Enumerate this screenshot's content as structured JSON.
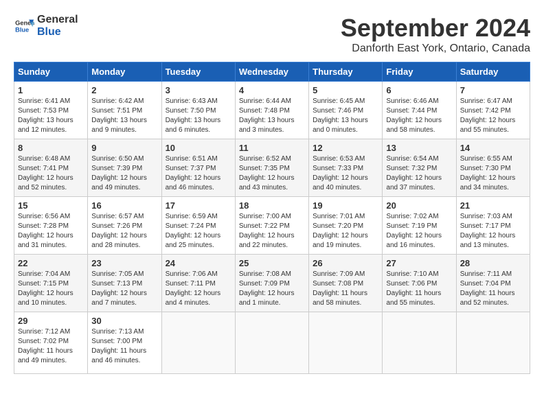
{
  "header": {
    "logo_general": "General",
    "logo_blue": "Blue",
    "month": "September 2024",
    "location": "Danforth East York, Ontario, Canada"
  },
  "days_of_week": [
    "Sunday",
    "Monday",
    "Tuesday",
    "Wednesday",
    "Thursday",
    "Friday",
    "Saturday"
  ],
  "weeks": [
    [
      {
        "day": "1",
        "sunrise": "6:41 AM",
        "sunset": "7:53 PM",
        "daylight": "13 hours and 12 minutes."
      },
      {
        "day": "2",
        "sunrise": "6:42 AM",
        "sunset": "7:51 PM",
        "daylight": "13 hours and 9 minutes."
      },
      {
        "day": "3",
        "sunrise": "6:43 AM",
        "sunset": "7:50 PM",
        "daylight": "13 hours and 6 minutes."
      },
      {
        "day": "4",
        "sunrise": "6:44 AM",
        "sunset": "7:48 PM",
        "daylight": "13 hours and 3 minutes."
      },
      {
        "day": "5",
        "sunrise": "6:45 AM",
        "sunset": "7:46 PM",
        "daylight": "13 hours and 0 minutes."
      },
      {
        "day": "6",
        "sunrise": "6:46 AM",
        "sunset": "7:44 PM",
        "daylight": "12 hours and 58 minutes."
      },
      {
        "day": "7",
        "sunrise": "6:47 AM",
        "sunset": "7:42 PM",
        "daylight": "12 hours and 55 minutes."
      }
    ],
    [
      {
        "day": "8",
        "sunrise": "6:48 AM",
        "sunset": "7:41 PM",
        "daylight": "12 hours and 52 minutes."
      },
      {
        "day": "9",
        "sunrise": "6:50 AM",
        "sunset": "7:39 PM",
        "daylight": "12 hours and 49 minutes."
      },
      {
        "day": "10",
        "sunrise": "6:51 AM",
        "sunset": "7:37 PM",
        "daylight": "12 hours and 46 minutes."
      },
      {
        "day": "11",
        "sunrise": "6:52 AM",
        "sunset": "7:35 PM",
        "daylight": "12 hours and 43 minutes."
      },
      {
        "day": "12",
        "sunrise": "6:53 AM",
        "sunset": "7:33 PM",
        "daylight": "12 hours and 40 minutes."
      },
      {
        "day": "13",
        "sunrise": "6:54 AM",
        "sunset": "7:32 PM",
        "daylight": "12 hours and 37 minutes."
      },
      {
        "day": "14",
        "sunrise": "6:55 AM",
        "sunset": "7:30 PM",
        "daylight": "12 hours and 34 minutes."
      }
    ],
    [
      {
        "day": "15",
        "sunrise": "6:56 AM",
        "sunset": "7:28 PM",
        "daylight": "12 hours and 31 minutes."
      },
      {
        "day": "16",
        "sunrise": "6:57 AM",
        "sunset": "7:26 PM",
        "daylight": "12 hours and 28 minutes."
      },
      {
        "day": "17",
        "sunrise": "6:59 AM",
        "sunset": "7:24 PM",
        "daylight": "12 hours and 25 minutes."
      },
      {
        "day": "18",
        "sunrise": "7:00 AM",
        "sunset": "7:22 PM",
        "daylight": "12 hours and 22 minutes."
      },
      {
        "day": "19",
        "sunrise": "7:01 AM",
        "sunset": "7:20 PM",
        "daylight": "12 hours and 19 minutes."
      },
      {
        "day": "20",
        "sunrise": "7:02 AM",
        "sunset": "7:19 PM",
        "daylight": "12 hours and 16 minutes."
      },
      {
        "day": "21",
        "sunrise": "7:03 AM",
        "sunset": "7:17 PM",
        "daylight": "12 hours and 13 minutes."
      }
    ],
    [
      {
        "day": "22",
        "sunrise": "7:04 AM",
        "sunset": "7:15 PM",
        "daylight": "12 hours and 10 minutes."
      },
      {
        "day": "23",
        "sunrise": "7:05 AM",
        "sunset": "7:13 PM",
        "daylight": "12 hours and 7 minutes."
      },
      {
        "day": "24",
        "sunrise": "7:06 AM",
        "sunset": "7:11 PM",
        "daylight": "12 hours and 4 minutes."
      },
      {
        "day": "25",
        "sunrise": "7:08 AM",
        "sunset": "7:09 PM",
        "daylight": "12 hours and 1 minute."
      },
      {
        "day": "26",
        "sunrise": "7:09 AM",
        "sunset": "7:08 PM",
        "daylight": "11 hours and 58 minutes."
      },
      {
        "day": "27",
        "sunrise": "7:10 AM",
        "sunset": "7:06 PM",
        "daylight": "11 hours and 55 minutes."
      },
      {
        "day": "28",
        "sunrise": "7:11 AM",
        "sunset": "7:04 PM",
        "daylight": "11 hours and 52 minutes."
      }
    ],
    [
      {
        "day": "29",
        "sunrise": "7:12 AM",
        "sunset": "7:02 PM",
        "daylight": "11 hours and 49 minutes."
      },
      {
        "day": "30",
        "sunrise": "7:13 AM",
        "sunset": "7:00 PM",
        "daylight": "11 hours and 46 minutes."
      },
      null,
      null,
      null,
      null,
      null
    ]
  ]
}
